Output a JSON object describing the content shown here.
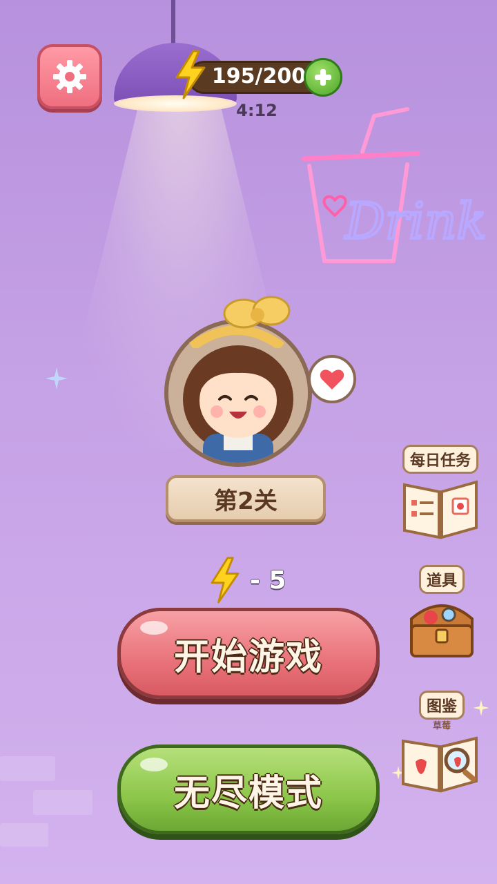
{
  "header": {
    "energy_text": "195/200",
    "timer": "4:12"
  },
  "neon_sign": {
    "text": "Drink"
  },
  "level": {
    "label": "第2关"
  },
  "cost": {
    "text": "- 5"
  },
  "buttons": {
    "start_label": "开始游戏",
    "endless_label": "无尽模式"
  },
  "side_menu": {
    "daily_tasks_label": "每日任务",
    "items_label": "道具",
    "collection_label": "图鉴",
    "collection_sublabel": "草莓"
  },
  "colors": {
    "background": "#c6a2e6",
    "start_button": "#e9727a",
    "endless_button": "#8cc64a",
    "settings_button": "#ef6f80"
  }
}
